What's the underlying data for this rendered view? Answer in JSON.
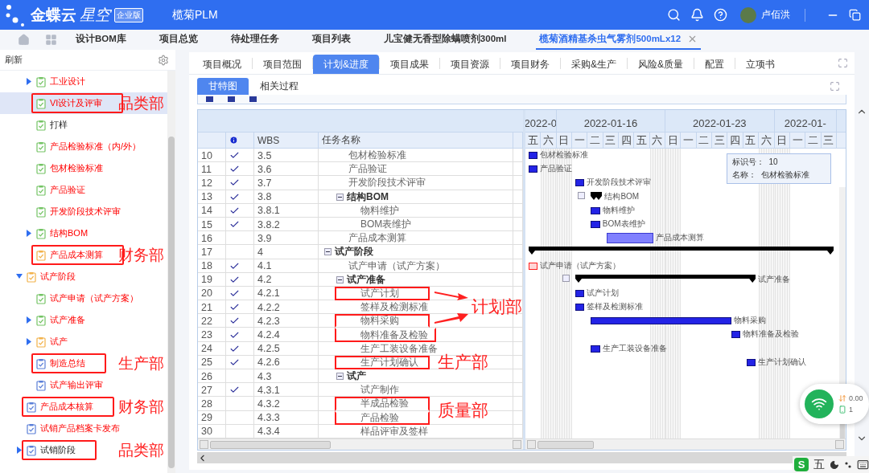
{
  "header": {
    "logo_main": "金蝶云",
    "logo_sub": "星空",
    "edition": "企业版",
    "app": "榄菊PLM",
    "user": "卢佰洪"
  },
  "nav_tabs": [
    {
      "label": "设计BOM库",
      "selected": false
    },
    {
      "label": "项目总览",
      "selected": false
    },
    {
      "label": "待处理任务",
      "selected": false
    },
    {
      "label": "项目列表",
      "selected": false
    },
    {
      "label": "儿宝健无香型除螨喷剂300ml",
      "selected": false
    },
    {
      "label": "榄菊酒精基杀虫气雾剂500mLx12",
      "selected": true,
      "closable": true
    }
  ],
  "sidebar": {
    "title": "刷新",
    "tree": [
      {
        "children": [
          {
            "label": "工业设计",
            "kind": "done",
            "flagged": true,
            "expanded": false,
            "selected": false
          },
          {
            "label": "VI设计及评审",
            "kind": "done",
            "flagged": true,
            "selected": true,
            "boxed": true,
            "note": "品类部"
          },
          {
            "label": "打样",
            "kind": "done",
            "flagged": false,
            "selected": false
          },
          {
            "label": "产品检验标准（内/外）",
            "kind": "done",
            "flagged": true,
            "selected": false
          },
          {
            "label": "包材检验标准",
            "kind": "done",
            "flagged": true,
            "selected": false
          },
          {
            "label": "产品验证",
            "kind": "done",
            "flagged": true,
            "selected": false
          },
          {
            "label": "开发阶段技术评审",
            "kind": "done",
            "flagged": true,
            "selected": false
          },
          {
            "label": "结构BOM",
            "kind": "done",
            "flagged": true,
            "expanded": false,
            "selected": false
          },
          {
            "label": "产品成本测算",
            "kind": "ongoing",
            "flagged": true,
            "selected": false,
            "boxed": true,
            "note": "财务部"
          }
        ]
      },
      {
        "label": "试产阶段",
        "kind": "ongoing",
        "flagged": true,
        "expanded": true,
        "selected": false,
        "children": [
          {
            "label": "试产申请（试产方案）",
            "kind": "done",
            "flagged": true,
            "selected": false
          },
          {
            "label": "试产准备",
            "kind": "done",
            "flagged": true,
            "expanded": false,
            "selected": false
          },
          {
            "label": "试产",
            "kind": "ongoing",
            "flagged": true,
            "expanded": false,
            "selected": false
          },
          {
            "label": "制造总结",
            "kind": "todo",
            "flagged": true,
            "selected": false,
            "boxed": true,
            "note": "生产部"
          },
          {
            "label": "试产输出评审",
            "kind": "todo",
            "flagged": true,
            "selected": false
          }
        ]
      },
      {
        "label": "产品成本核算",
        "kind": "todo",
        "flagged": true,
        "selected": false,
        "boxed": true,
        "note": "财务部"
      },
      {
        "label": "试销产品档案卡发布",
        "kind": "todo",
        "flagged": true,
        "selected": false
      },
      {
        "label": "试销阶段",
        "kind": "todo",
        "flagged": false,
        "expanded": false,
        "selected": false,
        "boxed": true,
        "note": "品类部"
      }
    ]
  },
  "main_tabs": [
    {
      "label": "项目概况",
      "selected": false
    },
    {
      "label": "项目范围",
      "selected": false
    },
    {
      "label": "计划&进度",
      "selected": true
    },
    {
      "label": "项目成果",
      "selected": false
    },
    {
      "label": "项目资源",
      "selected": false
    },
    {
      "label": "项目财务",
      "selected": false
    },
    {
      "label": "采购&生产",
      "selected": false
    },
    {
      "label": "风险&质量",
      "selected": false
    },
    {
      "label": "配置",
      "selected": false
    },
    {
      "label": "立项书",
      "selected": false
    }
  ],
  "sub_tabs": [
    {
      "label": "甘特图",
      "selected": true
    },
    {
      "label": "相关过程",
      "selected": false
    }
  ],
  "table": {
    "columns": [
      "WBS",
      "任务名称"
    ],
    "rows": [
      {
        "children": [
          {
            "num": "10",
            "done": true,
            "wbs": "3.5",
            "name": "包材检验标准",
            "bar": {
              "kind": "task",
              "label": "包材检验标准"
            }
          },
          {
            "num": "11",
            "done": true,
            "wbs": "3.6",
            "name": "产品验证",
            "bar": {
              "kind": "task",
              "label": "产品验证"
            }
          },
          {
            "num": "12",
            "done": true,
            "wbs": "3.7",
            "name": "开发阶段技术评审",
            "bar": {
              "kind": "task",
              "label": "开发阶段技术评审"
            }
          },
          {
            "num": "13",
            "done": true,
            "wbs": "3.8",
            "name": "结构BOM",
            "expanded": true,
            "bar": {
              "kind": "summary",
              "label": "结构BOM"
            },
            "children": [
              {
                "num": "14",
                "done": true,
                "wbs": "3.8.1",
                "name": "物料维护",
                "bar": {
                  "kind": "task",
                  "label": "物料维护"
                }
              },
              {
                "num": "15",
                "done": true,
                "wbs": "3.8.2",
                "name": "BOM表维护",
                "bar": {
                  "kind": "task",
                  "label": "BOM表维护"
                }
              }
            ]
          },
          {
            "num": "16",
            "done": false,
            "wbs": "3.9",
            "name": "产品成本测算",
            "bar": {
              "kind": "light",
              "label": "产品成本测算"
            }
          }
        ]
      },
      {
        "num": "17",
        "done": false,
        "wbs": "4",
        "name": "试产阶段",
        "expanded": true,
        "bar": {
          "kind": "summary"
        },
        "children": [
          {
            "num": "18",
            "done": true,
            "wbs": "4.1",
            "name": "试产申请（试产方案）",
            "bar": {
              "kind": "critical",
              "label": "试产申请（试产方案）"
            }
          },
          {
            "num": "19",
            "done": true,
            "wbs": "4.2",
            "name": "试产准备",
            "expanded": true,
            "bar": {
              "kind": "summary",
              "label": "试产准备"
            },
            "children": [
              {
                "num": "20",
                "done": true,
                "wbs": "4.2.1",
                "name": "试产计划",
                "boxed": true,
                "arrow": {
                  "kind": "down"
                },
                "bar": {
                  "kind": "task",
                  "label": "试产计划"
                }
              },
              {
                "num": "21",
                "done": true,
                "wbs": "4.2.2",
                "name": "签样及检测标准",
                "callout": "计划部",
                "bar": {
                  "kind": "task",
                  "label": "签样及检测标准"
                }
              },
              {
                "num": "22",
                "done": true,
                "wbs": "4.2.3",
                "name": "物料采购",
                "boxed": true,
                "arrow": {
                  "kind": "up"
                },
                "bar": {
                  "kind": "task",
                  "label": "物料采购"
                }
              },
              {
                "num": "23",
                "done": true,
                "wbs": "4.2.4",
                "name": "物料准备及检验",
                "boxed": true,
                "bar": {
                  "kind": "task",
                  "label": "物料准备及检验"
                }
              },
              {
                "num": "24",
                "done": true,
                "wbs": "4.2.5",
                "name": "生产工装设备准备",
                "bar": {
                  "kind": "task",
                  "label": "生产工装设备准备"
                }
              },
              {
                "num": "25",
                "done": true,
                "wbs": "4.2.6",
                "name": "生产计划确认",
                "boxed": true,
                "callout": "生产部",
                "bar": {
                  "kind": "task",
                  "label": "生产计划确认"
                }
              }
            ]
          },
          {
            "num": "26",
            "done": false,
            "wbs": "4.3",
            "name": "试产",
            "expanded": true,
            "children": [
              {
                "num": "27",
                "done": true,
                "wbs": "4.3.1",
                "name": "试产制作"
              },
              {
                "num": "28",
                "done": false,
                "wbs": "4.3.2",
                "name": "半成品检验",
                "boxed": true,
                "callout": "质量部"
              },
              {
                "num": "29",
                "done": false,
                "wbs": "4.3.3",
                "name": "产品检验",
                "boxed": true
              },
              {
                "num": "30",
                "done": false,
                "wbs": "4.3.4",
                "name": "样品评审及签样"
              }
            ]
          }
        ]
      }
    ]
  },
  "gantt": {
    "weeks": [
      {
        "label": "2022-0",
        "days": [
          {
            "label": "五",
            "weekend": false
          },
          {
            "label": "六",
            "weekend": true
          }
        ]
      },
      {
        "label": "2022-01-16",
        "days": [
          {
            "label": "日",
            "weekend": true
          },
          {
            "label": "一",
            "weekend": false
          },
          {
            "label": "二",
            "weekend": false
          },
          {
            "label": "三",
            "weekend": false
          },
          {
            "label": "四",
            "weekend": false
          },
          {
            "label": "五",
            "weekend": false
          },
          {
            "label": "六",
            "weekend": true
          }
        ]
      },
      {
        "label": "2022-01-23",
        "days": [
          {
            "label": "日",
            "weekend": true
          },
          {
            "label": "一",
            "weekend": false
          },
          {
            "label": "二",
            "weekend": false
          },
          {
            "label": "三",
            "weekend": false
          },
          {
            "label": "四",
            "weekend": false
          },
          {
            "label": "五",
            "weekend": false
          },
          {
            "label": "六",
            "weekend": true
          }
        ]
      },
      {
        "label": "2022-01-",
        "days": [
          {
            "label": "日",
            "weekend": true
          },
          {
            "label": "一",
            "weekend": false
          },
          {
            "label": "二",
            "weekend": false
          },
          {
            "label": "三",
            "weekend": false
          }
        ]
      }
    ],
    "tooltip": [
      "标识号：  10",
      "名称：  包材检验标准"
    ]
  },
  "network_widget": {
    "speed": "0.00",
    "devices": "1"
  },
  "ime_bar": {
    "logo": "S",
    "mode": "五"
  }
}
